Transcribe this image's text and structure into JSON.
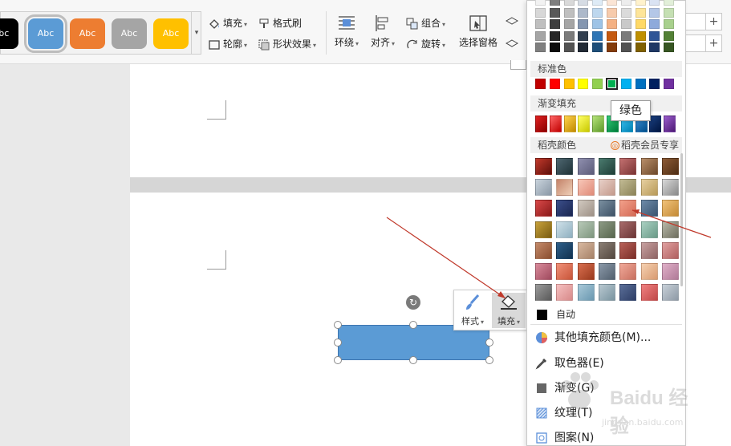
{
  "ribbon": {
    "style_swatches": [
      {
        "label": "Abc",
        "color": "#000000",
        "text": "#ffffff"
      },
      {
        "label": "Abc",
        "color": "#5b9bd5",
        "text": "#ffffff",
        "selected": true
      },
      {
        "label": "Abc",
        "color": "#ed7d31",
        "text": "#ffffff"
      },
      {
        "label": "Abc",
        "color": "#a5a5a5",
        "text": "#ffffff"
      },
      {
        "label": "Abc",
        "color": "#ffc000",
        "text": "#ffffff"
      }
    ],
    "fill_label": "填充",
    "format_painter_label": "格式刷",
    "outline_label": "轮廓",
    "shape_effects_label": "形状效果",
    "wrap_label": "环绕",
    "align_label": "对齐",
    "group_label": "组合",
    "rotate_label": "旋转",
    "selection_pane_label": "选择窗格",
    "spinner_plus": "+"
  },
  "mini_toolbar": {
    "style_label": "样式",
    "fill_label": "填充"
  },
  "shape": {
    "fill": "#5b9bd5"
  },
  "color_menu": {
    "theme_grid": [
      [
        "#f2f2f2",
        "#7f7f7f",
        "#d9d9d9",
        "#d6dce4",
        "#deebf6",
        "#fbe5d5",
        "#ededed",
        "#fff2cc",
        "#dae3f3",
        "#e2efd9"
      ],
      [
        "#d8d8d8",
        "#595959",
        "#bfbfbf",
        "#adb9ca",
        "#bdd7ee",
        "#f7cbac",
        "#dbdbdb",
        "#fee599",
        "#b4c7e7",
        "#c5e0b3"
      ],
      [
        "#bfbfbf",
        "#3f3f3f",
        "#a5a5a5",
        "#8496b0",
        "#9dc3e6",
        "#f4b183",
        "#c9c9c9",
        "#ffd966",
        "#8eaadb",
        "#a8d08d"
      ],
      [
        "#a5a5a5",
        "#262626",
        "#7b7b7b",
        "#323f4f",
        "#2e75b5",
        "#c55a11",
        "#7b7b7b",
        "#bf9000",
        "#2f5597",
        "#538135"
      ],
      [
        "#7f7f7f",
        "#0c0c0c",
        "#525252",
        "#222a35",
        "#1e4e79",
        "#833c0b",
        "#525252",
        "#7f6000",
        "#1f3864",
        "#375623"
      ]
    ],
    "standard_label": "标准色",
    "standard_colors": [
      "#c00000",
      "#ff0000",
      "#ffc000",
      "#ffff00",
      "#92d050",
      "#00b050",
      "#00b0f0",
      "#0070c0",
      "#002060",
      "#7030a0"
    ],
    "selected_standard_index": 5,
    "gradient_label": "渐变填充",
    "gradient_colors": [
      [
        "#e02020",
        "#8a0000"
      ],
      [
        "#ff6666",
        "#c00000"
      ],
      [
        "#ffd24d",
        "#c08a00"
      ],
      [
        "#ffff66",
        "#c8c800"
      ],
      [
        "#b6e37a",
        "#5e9a2a"
      ],
      [
        "#33cc77",
        "#007a3a"
      ],
      [
        "#40c4f4",
        "#0082b3"
      ],
      [
        "#3a8fd6",
        "#004e8a"
      ],
      [
        "#1a3f80",
        "#001540"
      ],
      [
        "#9a5ccc",
        "#4d1a75"
      ]
    ],
    "shell_label": "稻壳颜色",
    "shell_vip_label": "稻壳会员专享",
    "shell_vip_icon": "shell-icon",
    "shell_grid": [
      [
        [
          "#c1392b",
          "#5e0f0a"
        ],
        [
          "#4e6670",
          "#1f3338"
        ],
        [
          "#8f8fae",
          "#5c5c7a"
        ],
        [
          "#4a7a6e",
          "#1f3f38"
        ],
        [
          "#c47070",
          "#7a3535"
        ],
        [
          "#b88d68",
          "#6e4a2c"
        ],
        [
          "#8c5a35",
          "#4f2e14"
        ]
      ],
      [
        [
          "#c9d3dc",
          "#8a98a6"
        ],
        [
          "#c4836a",
          "#efd0b8"
        ],
        [
          "#f7c7b8",
          "#e08a78"
        ],
        [
          "#e8d0c8",
          "#c49a8c"
        ],
        [
          "#c2bb94",
          "#8c8358"
        ],
        [
          "#e6cfa0",
          "#b89a58"
        ],
        [
          "#d8d8d8",
          "#8a8a8a"
        ]
      ],
      [
        [
          "#d94848",
          "#8a1a1a"
        ],
        [
          "#3b4e8a",
          "#1a2650"
        ],
        [
          "#d1c9c0",
          "#9e9186"
        ],
        [
          "#7a8fa0",
          "#3e5266"
        ],
        [
          "#f2a08a",
          "#d46a55"
        ],
        [
          "#6d8aa8",
          "#3a5570"
        ],
        [
          "#f0c27a",
          "#c48a35"
        ]
      ],
      [
        [
          "#c7a13a",
          "#7a5c12"
        ],
        [
          "#cfe0e8",
          "#8fb0c0"
        ],
        [
          "#b8c9b8",
          "#7e967e"
        ],
        [
          "#8c9a84",
          "#58664e"
        ],
        [
          "#a86b6b",
          "#6b3535"
        ],
        [
          "#a8cfc0",
          "#6a9a88"
        ],
        [
          "#b8b8a8",
          "#6e6e5e"
        ]
      ],
      [
        [
          "#c48a6a",
          "#8a4e30"
        ],
        [
          "#2e5f8a",
          "#123250"
        ],
        [
          "#d8b8a0",
          "#a68268"
        ],
        [
          "#8a7e74",
          "#544840"
        ],
        [
          "#b86058",
          "#7a2e28"
        ],
        [
          "#c8a0a0",
          "#8e6464"
        ],
        [
          "#e0a0a0",
          "#b06060"
        ]
      ],
      [
        [
          "#d88a9a",
          "#a04a5e"
        ],
        [
          "#f09078",
          "#c8553a"
        ],
        [
          "#d86e4e",
          "#9a3a1e"
        ],
        [
          "#8a98a8",
          "#52606e"
        ],
        [
          "#f0a898",
          "#c87060"
        ],
        [
          "#f5d0b0",
          "#d89a70"
        ],
        [
          "#e0b0c8",
          "#b07a98"
        ]
      ],
      [
        [
          "#9a9a9a",
          "#5a5a5a"
        ],
        [
          "#f5c0c0",
          "#d88a8a"
        ],
        [
          "#a8c8d8",
          "#6a98b0"
        ],
        [
          "#b8c8d0",
          "#7a94a0"
        ],
        [
          "#5a6e98",
          "#2e3e66"
        ],
        [
          "#f08080",
          "#c04848"
        ],
        [
          "#c8d0d8",
          "#8e9aa6"
        ]
      ]
    ],
    "auto_label": "自动",
    "more_colors_label": "其他填充颜色(M)...",
    "more_colors_icon": "palette-icon",
    "eyedropper_label": "取色器(E)",
    "eyedropper_icon": "eyedropper-icon",
    "gradient_item_label": "渐变(G)",
    "gradient_item_icon": "gradient-icon",
    "texture_label": "纹理(T)",
    "texture_icon": "texture-icon",
    "pattern_label": "图案(N)",
    "pattern_icon": "pattern-icon"
  },
  "tooltip": {
    "text": "绿色"
  },
  "watermark": {
    "brand": "Baidu 经验",
    "url": "jingyan.baidu.com"
  },
  "colors": {
    "accent": "#5b8fd9",
    "arrow": "#c0392b"
  }
}
